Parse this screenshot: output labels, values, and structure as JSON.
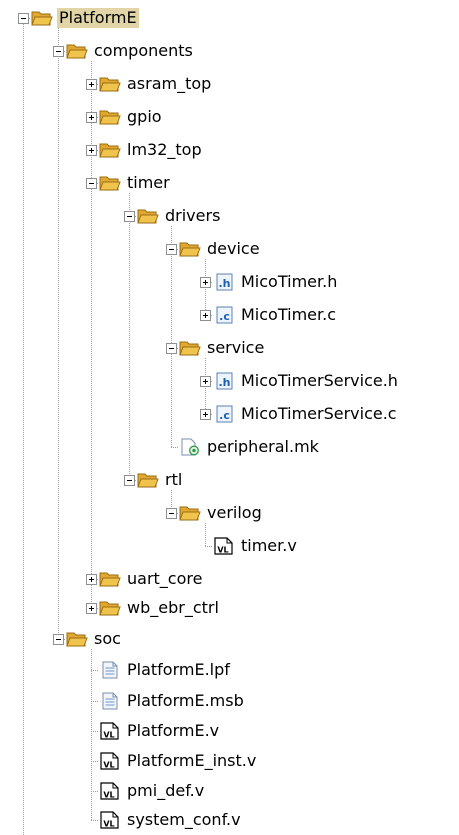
{
  "tree": {
    "root": {
      "label": "PlatformE",
      "icon": "folder-icon",
      "expanded": true,
      "selected": true
    },
    "components": {
      "label": "components",
      "icon": "folder-icon",
      "expanded": true
    },
    "asram_top": {
      "label": "asram_top",
      "icon": "folder-icon",
      "expanded": false
    },
    "gpio": {
      "label": "gpio",
      "icon": "folder-icon",
      "expanded": false
    },
    "lm32_top": {
      "label": "lm32_top",
      "icon": "folder-icon",
      "expanded": false
    },
    "timer": {
      "label": "timer",
      "icon": "folder-icon",
      "expanded": true
    },
    "drivers": {
      "label": "drivers",
      "icon": "folder-icon",
      "expanded": true
    },
    "device": {
      "label": "device",
      "icon": "folder-icon",
      "expanded": true
    },
    "mico_timer_h": {
      "label": "MicoTimer.h",
      "icon": "header-file-icon",
      "icon_text": ".h",
      "expanded": false
    },
    "mico_timer_c": {
      "label": "MicoTimer.c",
      "icon": "c-file-icon",
      "icon_text": ".c",
      "expanded": false
    },
    "service": {
      "label": "service",
      "icon": "folder-icon",
      "expanded": true
    },
    "mico_timer_service_h": {
      "label": "MicoTimerService.h",
      "icon": "header-file-icon",
      "icon_text": ".h",
      "expanded": false
    },
    "mico_timer_service_c": {
      "label": "MicoTimerService.c",
      "icon": "c-file-icon",
      "icon_text": ".c",
      "expanded": false
    },
    "peripheral_mk": {
      "label": "peripheral.mk",
      "icon": "makefile-icon"
    },
    "rtl": {
      "label": "rtl",
      "icon": "folder-icon",
      "expanded": true
    },
    "verilog": {
      "label": "verilog",
      "icon": "folder-icon",
      "expanded": true
    },
    "timer_v": {
      "label": "timer.v",
      "icon": "verilog-file-icon",
      "icon_text": "VL"
    },
    "uart_core": {
      "label": "uart_core",
      "icon": "folder-icon",
      "expanded": false
    },
    "wb_ebr_ctrl": {
      "label": "wb_ebr_ctrl",
      "icon": "folder-icon",
      "expanded": false
    },
    "soc": {
      "label": "soc",
      "icon": "folder-icon",
      "expanded": true
    },
    "platforme_lpf": {
      "label": "PlatformE.lpf",
      "icon": "text-file-icon"
    },
    "platforme_msb": {
      "label": "PlatformE.msb",
      "icon": "text-file-icon"
    },
    "platforme_v": {
      "label": "PlatformE.v",
      "icon": "verilog-file-icon",
      "icon_text": "VL"
    },
    "platforme_inst_v": {
      "label": "PlatformE_inst.v",
      "icon": "verilog-file-icon",
      "icon_text": "VL"
    },
    "pmi_def_v": {
      "label": "pmi_def.v",
      "icon": "verilog-file-icon",
      "icon_text": "VL"
    },
    "system_conf_v": {
      "label": "system_conf.v",
      "icon": "verilog-file-icon",
      "icon_text": "VL"
    }
  },
  "colors": {
    "selection": "#e1d4a6",
    "folder": "#f0c44c",
    "guide": "#a0a0a0"
  }
}
